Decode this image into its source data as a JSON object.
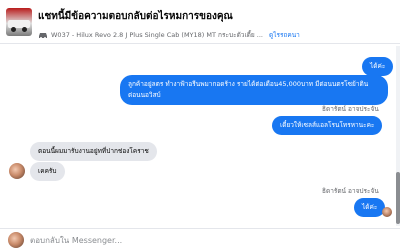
{
  "header": {
    "title": "แชทนี้มีข้อความตอบกลับต่อไรหมการของคุณ",
    "subtitle": "W037 - Hilux Revo 2.8 J Plus Single Cab (MY18) MT กระบะตัวเตี้ย ...",
    "link": "ดูไรรถคนา"
  },
  "messages": [
    {
      "id": "m1",
      "direction": "out",
      "text": "ได้ค่ะ"
    },
    {
      "id": "m2",
      "direction": "out",
      "line1": "ลูกค้าอยู่ลตร ทำงาฟ้าอรีนพมากอดร้าง รายได้ต่อเดือน45,000บาท มีต่อนนตรโซย้าติน",
      "line2": "ต่อนนอวิสบ์"
    },
    {
      "id": "m3",
      "direction": "out",
      "sender": "ธิดารัตน์ อาจประจัน",
      "text": "เดี๋ยวให้เซลส์แอลโรนโทรหานะคะ"
    },
    {
      "id": "m4",
      "direction": "in",
      "text": "ตอนนี้ผมมารับงานอยู่ทที่ปากช่องโคราช"
    },
    {
      "id": "m5",
      "direction": "in",
      "text": "เคครับ"
    },
    {
      "id": "m6",
      "direction": "out",
      "sender": "ธิดารัตน์ อาจประจัน",
      "text": "ได้ค่ะ"
    }
  ],
  "composer": {
    "placeholder": "ตอบกลับใน Messenger..."
  },
  "colors": {
    "accent": "#1877f2",
    "incoming": "#e4e6eb"
  },
  "icons": {
    "car": "car-icon",
    "avatar": "customer-avatar"
  }
}
